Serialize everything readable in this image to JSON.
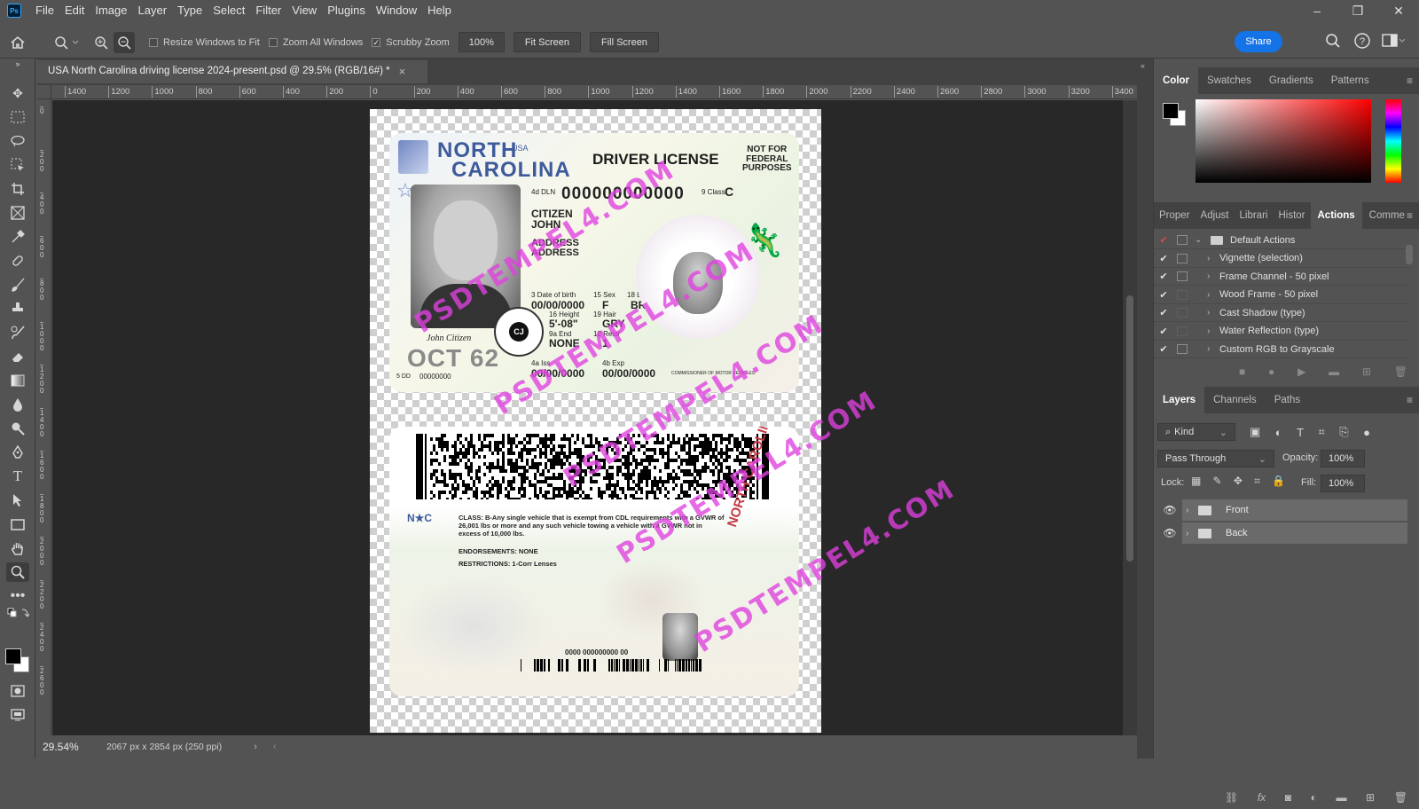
{
  "menu": {
    "logo": "Ps",
    "items": [
      "File",
      "Edit",
      "Image",
      "Layer",
      "Type",
      "Select",
      "Filter",
      "View",
      "Plugins",
      "Window",
      "Help"
    ]
  },
  "window_controls": {
    "minimize": "–",
    "restore": "❐",
    "close": "✕"
  },
  "options_bar": {
    "resize_windows": "Resize Windows to Fit",
    "zoom_all": "Zoom All Windows",
    "scrubby_zoom": "Scrubby Zoom",
    "zoom_value": "100%",
    "fit_screen": "Fit Screen",
    "fill_screen": "Fill Screen",
    "share": "Share"
  },
  "document_tab": {
    "title": "USA North Carolina driving license 2024-present.psd @ 29.5% (RGB/16#) *",
    "close": "×"
  },
  "ruler_h": [
    "1400",
    "1200",
    "1000",
    "800",
    "600",
    "400",
    "200",
    "0",
    "200",
    "400",
    "600",
    "800",
    "1000",
    "1200",
    "1400",
    "1600",
    "1800",
    "2000",
    "2200",
    "2400",
    "2600",
    "2800",
    "3000",
    "3200",
    "3400"
  ],
  "ruler_v": [
    "0",
    "2\n0\n0",
    "4\n0\n0",
    "6\n0\n0",
    "8\n0\n0",
    "1\n0\n0\n0",
    "1\n2\n0\n0",
    "1\n4\n0\n0",
    "1\n6\n0\n0",
    "1\n8\n0\n0",
    "2\n0\n0\n0",
    "2\n2\n0\n0",
    "2\n4\n0\n0",
    "2\n6\n0\n0"
  ],
  "status": {
    "zoom": "29.54%",
    "doc_size": "2067 px x 2854 px (250 ppi)"
  },
  "license_front": {
    "state1": "NORTH",
    "usa": "USA",
    "state2": "CAROLINA",
    "title": "DRIVER LICENSE",
    "not_federal": "NOT FOR\nFEDERAL\nPURPOSES",
    "dln_label": "4d DLN",
    "dln": "000000000000",
    "class_label": "9 Class",
    "class_value": "C",
    "last_name": "CITIZEN",
    "first_name": "JOHN",
    "address1": "ADDRESS",
    "address2": "ADDRESS",
    "dob_label": "3 Date of birth",
    "dob": "00/00/0000",
    "sex_label": "15 Sex",
    "sex": "F",
    "eyes_label": "18 Eyes",
    "eyes": "BRO",
    "height_label": "16 Height",
    "height": "5'-08\"",
    "hair_label": "19 Hair",
    "hair": "GRY",
    "end_label": "9a End",
    "end": "NONE",
    "restr_label": "12 Restr",
    "restr": "1",
    "iss_label": "4a Iss",
    "iss": "00/00/0000",
    "exp_label": "4b Exp",
    "exp": "00/00/0000",
    "signature": "John Citizen",
    "dob_big": "OCT 62",
    "dd_label": "5 DD",
    "dd": "00000000",
    "seal": "CJ",
    "commissioner": "COMMISSIONER OF MOTOR VEHICLES"
  },
  "license_back": {
    "nc": "N★C",
    "class_text": "CLASS: B-Any single vehicle that is exempt from CDL requirements with a GVWR of 26,001 lbs or more and any such vehicle towing a vehicle with a GVWR not in excess of 10,000 lbs.",
    "endorsements": "ENDORSEMENTS: NONE",
    "restrictions": "RESTRICTIONS: 1-Corr Lenses",
    "side_state": "NORTH CAROLINA",
    "barcode_number": "0000 000000000 00"
  },
  "watermark": "PSDTEMPEL4.COM",
  "color_panel": {
    "tabs": [
      "Color",
      "Swatches",
      "Gradients",
      "Patterns"
    ],
    "active": "Color"
  },
  "actions_panel": {
    "tabs": [
      "Proper",
      "Adjust",
      "Librari",
      "Histor",
      "Actions",
      "Comme"
    ],
    "active": "Actions",
    "items": [
      {
        "name": "Default Actions",
        "checked": true,
        "box": true,
        "folder": true
      },
      {
        "name": "Vignette (selection)",
        "checked": true,
        "box": true
      },
      {
        "name": "Frame Channel - 50 pixel",
        "checked": true,
        "box": true
      },
      {
        "name": "Wood Frame - 50 pixel",
        "checked": true,
        "box": false
      },
      {
        "name": "Cast Shadow (type)",
        "checked": true,
        "box": false
      },
      {
        "name": "Water Reflection (type)",
        "checked": true,
        "box": false
      },
      {
        "name": "Custom RGB to Grayscale",
        "checked": true,
        "box": true
      }
    ]
  },
  "layers_panel": {
    "tabs": [
      "Layers",
      "Channels",
      "Paths"
    ],
    "active": "Layers",
    "kind": "Kind",
    "blend_mode": "Pass Through",
    "opacity_label": "Opacity:",
    "opacity": "100%",
    "lock_label": "Lock:",
    "fill_label": "Fill:",
    "fill": "100%",
    "layers": [
      {
        "name": "Front"
      },
      {
        "name": "Back"
      }
    ]
  },
  "colors": {
    "accent": "#1473e6",
    "watermark": "#e040e0",
    "ps_blue": "#31a8ff"
  }
}
